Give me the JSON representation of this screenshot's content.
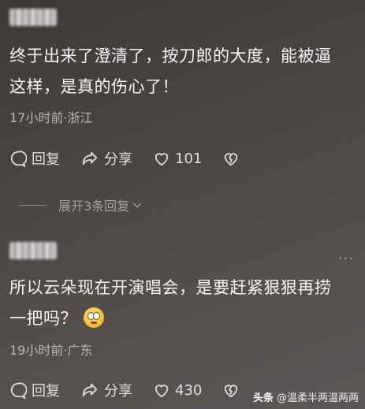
{
  "comments": [
    {
      "text_line1": "终于出来了澄清了，按刀郎的大度，能被逼",
      "text_line2": "这样，是真的伤心了！",
      "meta": "17小时前·浙江",
      "reply_label": "回复",
      "share_label": "分享",
      "like_count": "101"
    },
    {
      "text_line1": "所以云朵现在开演唱会，是要赶紧狠狠再捞",
      "text_line2": "一把吗？",
      "meta": "19小时前·广东",
      "reply_label": "回复",
      "share_label": "分享",
      "like_count": "430"
    }
  ],
  "expand_replies_label": "展开3条回复",
  "more_icon": "more-dots-icon",
  "watermark": {
    "brand": "头条",
    "handle": "@温柔半两温两两"
  },
  "colors": {
    "background": "#4a4442",
    "text": "#f4f4f4",
    "meta": "#b9b6b4"
  }
}
